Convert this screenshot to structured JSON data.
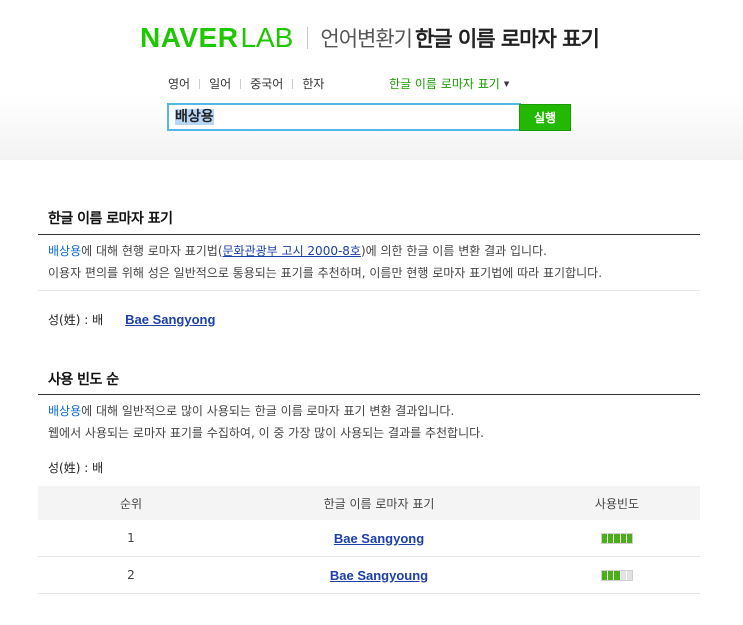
{
  "header": {
    "logo_naver": "NAVER",
    "logo_lab": "LAB",
    "service": "언어변환기",
    "title": "한글 이름 로마자 표기"
  },
  "nav": {
    "items": [
      {
        "label": "영어"
      },
      {
        "label": "일어"
      },
      {
        "label": "중국어"
      },
      {
        "label": "한자"
      }
    ],
    "active": "한글 이름 로마자 표기"
  },
  "search": {
    "value": "배상용",
    "button": "실행"
  },
  "section1": {
    "title": "한글 이름 로마자 표기",
    "name": "배상용",
    "desc1_a": "에 대해 현행 로마자 표기법(",
    "link": "문화관광부 고시 2000-8호",
    "desc1_b": ")에 의한 한글 이름 변환 결과 입니다.",
    "desc2": "이용자 편의를 위해 성은 일반적으로 통용되는 표기를 추천하며, 이름만 현행 로마자 표기법에 따라 표기합니다.",
    "surname_label": "성(姓) : 배",
    "result": "Bae Sangyong"
  },
  "section2": {
    "title": "사용 빈도 순",
    "name": "배상용",
    "desc1": "에 대해 일반적으로 많이 사용되는 한글 이름 로마자 표기 변환 결과입니다.",
    "desc2": "웹에서 사용되는 로마자 표기를 수집하여, 이 중 가장 많이 사용되는 결과를 추천합니다.",
    "surname_label": "성(姓) : 배",
    "table": {
      "headers": [
        "순위",
        "한글 이름 로마자 표기",
        "사용빈도"
      ],
      "rows": [
        {
          "rank": "1",
          "romanization": "Bae Sangyong",
          "frequency": 1.0
        },
        {
          "rank": "2",
          "romanization": "Bae Sangyoung",
          "frequency": 0.6
        }
      ]
    }
  },
  "colors": {
    "brand": "#1ec800",
    "bar_filled": "#4caf1a",
    "bar_empty": "#e3e3e3"
  }
}
